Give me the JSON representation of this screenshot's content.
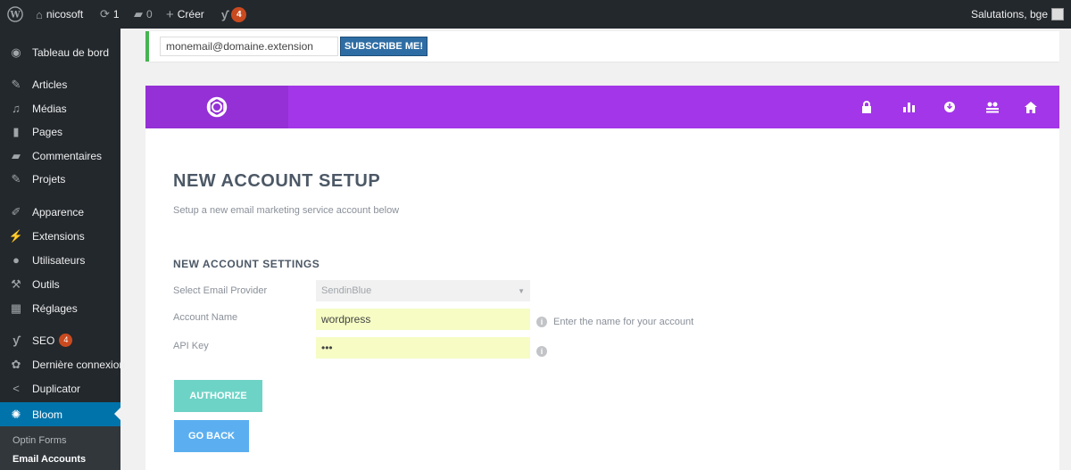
{
  "adminbar": {
    "site_name": "nicosoft",
    "updates_count": "1",
    "comments_count": "0",
    "new_label": "Créer",
    "seo_badge": "4",
    "howdy": "Salutations, bge"
  },
  "sidebar": {
    "items": [
      {
        "label": "Tableau de bord",
        "icon": "dashboard-icon"
      },
      {
        "label": "Articles",
        "icon": "pin-icon"
      },
      {
        "label": "Médias",
        "icon": "media-icon"
      },
      {
        "label": "Pages",
        "icon": "page-icon"
      },
      {
        "label": "Commentaires",
        "icon": "comment-icon"
      },
      {
        "label": "Projets",
        "icon": "pin-icon"
      },
      {
        "label": "Apparence",
        "icon": "brush-icon"
      },
      {
        "label": "Extensions",
        "icon": "plugin-icon"
      },
      {
        "label": "Utilisateurs",
        "icon": "users-icon"
      },
      {
        "label": "Outils",
        "icon": "wrench-icon"
      },
      {
        "label": "Réglages",
        "icon": "settings-icon"
      },
      {
        "label": "SEO",
        "icon": "yoast-icon",
        "badge": "4"
      },
      {
        "label": "Dernière connexion",
        "icon": "gear-icon"
      },
      {
        "label": "Duplicator",
        "icon": "share-icon"
      },
      {
        "label": "Bloom",
        "icon": "bloom-icon"
      }
    ],
    "submenu": [
      "Optin Forms",
      "Email Accounts"
    ]
  },
  "notice": {
    "email_value": "monemail@domaine.extension",
    "subscribe_label": "SUBSCRIBE ME!"
  },
  "bloom": {
    "header_icons": [
      "lock-icon",
      "stats-icon",
      "import-icon",
      "accounts-icon",
      "home-icon"
    ],
    "title": "NEW ACCOUNT SETUP",
    "subtitle": "Setup a new email marketing service account below",
    "section_title": "NEW ACCOUNT SETTINGS",
    "provider_label": "Select Email Provider",
    "provider_value": "SendinBlue",
    "account_label": "Account Name",
    "account_value": "wordpress",
    "account_hint": "Enter the name for your account",
    "api_label": "API Key",
    "api_value": "•••",
    "authorize_label": "AUTHORIZE",
    "back_label": "GO BACK"
  },
  "colors": {
    "wp_dark": "#23282d",
    "wp_blue": "#0073aa",
    "bloom_purple": "#a336e8",
    "authorize": "#6dd3c6",
    "go_back": "#5baff0",
    "input_yellow": "#f6fcc4",
    "notice_green": "#46b450"
  }
}
